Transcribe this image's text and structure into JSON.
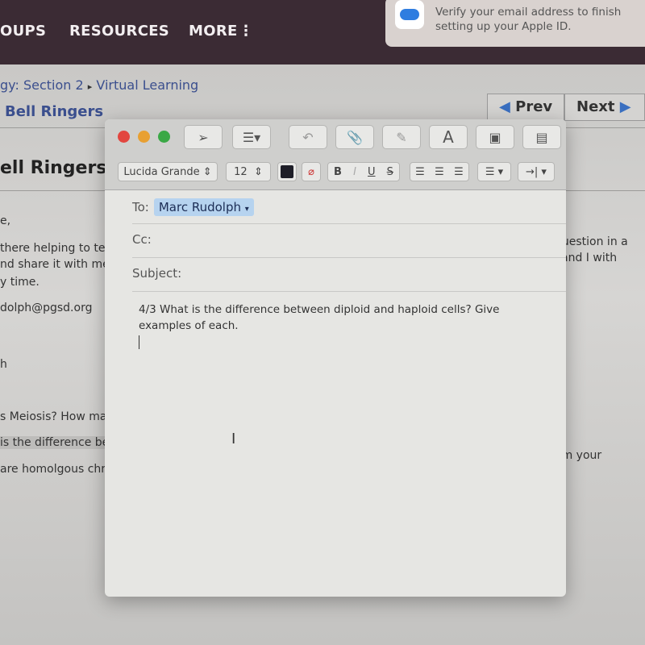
{
  "topnav": {
    "items": [
      "OUPS",
      "RESOURCES",
      "MORE"
    ],
    "more_icon": "vertical-ellipsis-icon"
  },
  "notification": {
    "icon": "icloud-icon",
    "line1": "Verify your email address to finish",
    "line2": "setting up your Apple ID."
  },
  "page": {
    "breadcrumb": {
      "part1": "gy: Section 2",
      "separator": "▸",
      "part2": "Virtual Learning"
    },
    "subtitle": "Bell Ringers",
    "prev": "Prev",
    "next": "Next",
    "heading": "ell Ringers",
    "left_lines": [
      "e,",
      "there helping to teac",
      "nd share it with me",
      "y time.",
      "dolph@pgsd.org",
      "h",
      "s Meiosis? How many c",
      "is the difference betwe",
      "are homolgous chromo"
    ],
    "right_lines": [
      "question in a",
      "and I with",
      "om your"
    ]
  },
  "compose": {
    "font": "Lucida Grande",
    "size": "12",
    "to_label": "To:",
    "to_value": "Marc Rudolph",
    "cc_label": "Cc:",
    "subject_label": "Subject:",
    "body_line1": "4/3 What is the difference between diploid and haploid cells?  Give",
    "body_line2": "examples of each.",
    "colors": {
      "close": "#e2463f",
      "minimize": "#e8a032",
      "zoom": "#3aa845",
      "recipient_chip": "#b6d3ef"
    }
  }
}
